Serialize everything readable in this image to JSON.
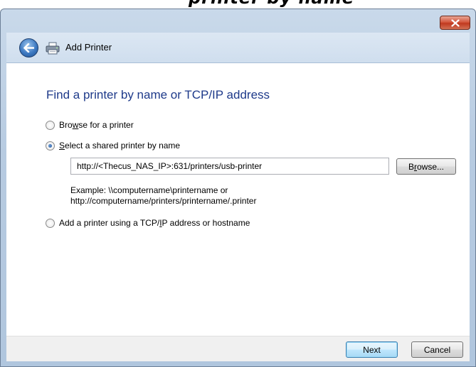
{
  "caption_fragment": "printer by name",
  "window": {
    "title": "Add Printer",
    "close_icon": "close-x-icon",
    "back_icon": "back-arrow-icon",
    "printer_icon": "printer-icon"
  },
  "main": {
    "heading": "Find a printer by name or TCP/IP address",
    "options": [
      {
        "pre": "Bro",
        "key": "w",
        "post": "se for a printer",
        "checked": false
      },
      {
        "pre": "",
        "key": "S",
        "post": "elect a shared printer by name",
        "checked": true
      },
      {
        "pre": "Add a printer using a TCP/",
        "key": "I",
        "post": "P address or hostname",
        "checked": false
      }
    ],
    "printer_url": "http://<Thecus_NAS_IP>:631/printers/usb-printer",
    "browse": {
      "pre": "B",
      "key": "r",
      "post": "owse..."
    },
    "example_line1": "Example: \\\\computername\\printername or",
    "example_line2": "http://computername/printers/printername/.printer"
  },
  "footer": {
    "next_label": "Next",
    "cancel_label": "Cancel"
  },
  "colors": {
    "heading": "#1e3a8a",
    "frame": "#b7cbe1",
    "close": "#c0391f"
  }
}
